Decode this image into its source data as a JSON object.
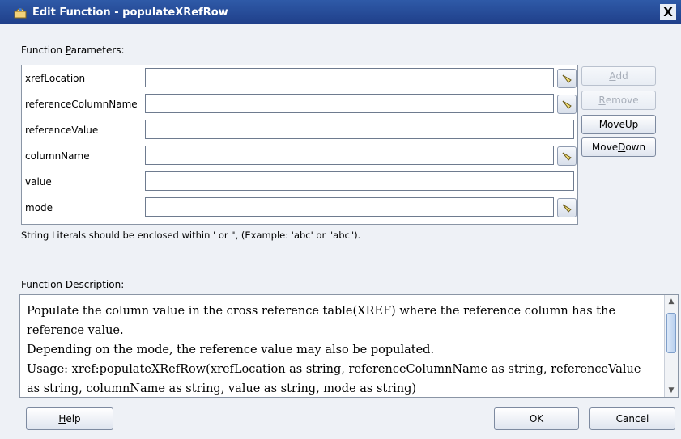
{
  "window": {
    "title": "Edit Function - populateXRefRow",
    "close_label": "X"
  },
  "params": {
    "heading_pre": "Function ",
    "heading_u": "P",
    "heading_post": "arameters:",
    "rows": [
      {
        "name": "xrefLocation",
        "value": ""
      },
      {
        "name": "referenceColumnName",
        "value": ""
      },
      {
        "name": "referenceValue",
        "value": ""
      },
      {
        "name": "columnName",
        "value": ""
      },
      {
        "name": "value",
        "value": ""
      },
      {
        "name": "mode",
        "value": ""
      }
    ],
    "hint": "String Literals should be enclosed within ' or \", (Example: 'abc' or \"abc\")."
  },
  "side_buttons": {
    "add_u": "A",
    "add_rest": "dd",
    "remove_u": "R",
    "remove_rest": "emove",
    "moveup_pre": "Move ",
    "moveup_u": "U",
    "moveup_rest": "p",
    "movedown_pre": "Move ",
    "movedown_u": "D",
    "movedown_rest": "own"
  },
  "description": {
    "heading": "Function Description:",
    "lines": [
      "Populate the column value in the cross reference table(XREF) where the reference column has the",
      "reference value.",
      "Depending on the mode, the reference value may also be populated.",
      "Usage: xref:populateXRefRow(xrefLocation as string, referenceColumnName as string, referenceValue",
      "as string, columnName as string, value as string, mode as string)"
    ]
  },
  "footer": {
    "help_u": "H",
    "help_rest": "elp",
    "ok_label": "OK",
    "cancel_label": "Cancel"
  }
}
